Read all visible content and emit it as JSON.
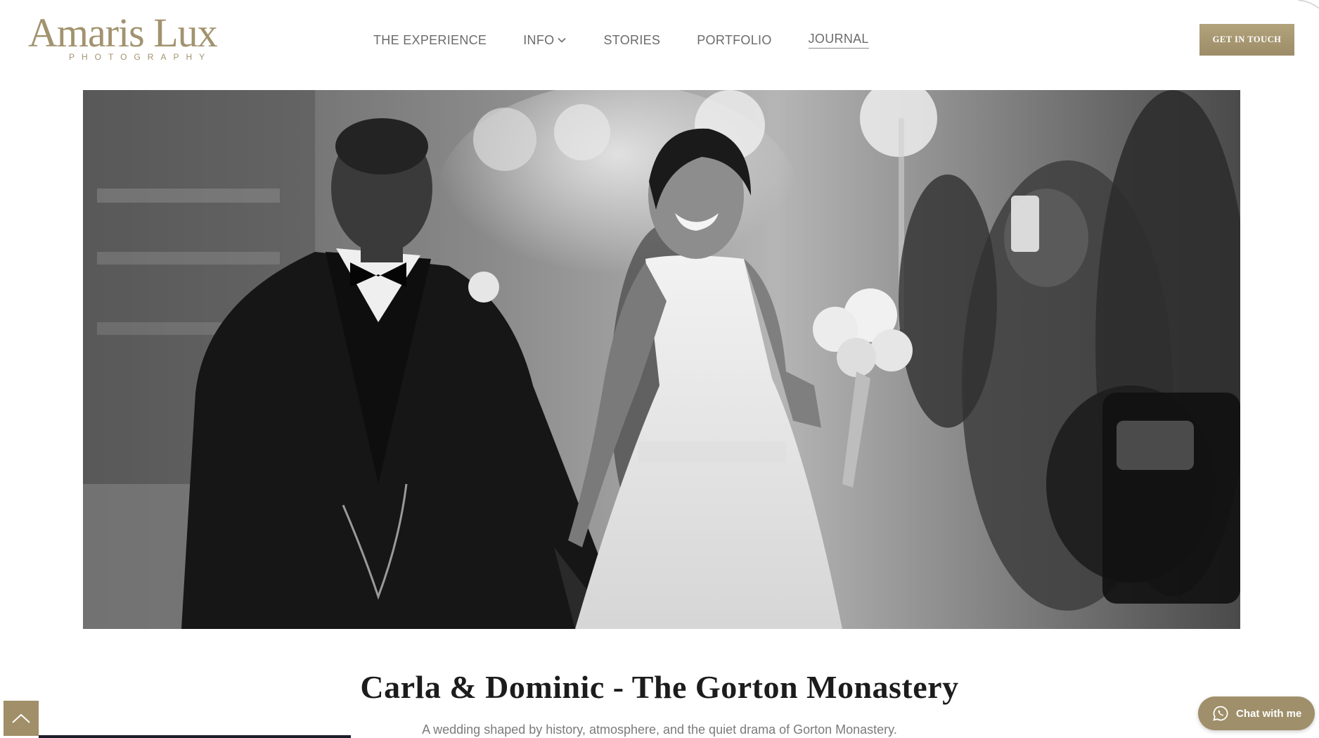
{
  "brand": {
    "name": "Amaris Lux",
    "tagline": "PHOTOGRAPHY"
  },
  "nav": {
    "items": [
      {
        "label": "THE EXPERIENCE"
      },
      {
        "label": "INFO"
      },
      {
        "label": "STORIES"
      },
      {
        "label": "PORTFOLIO"
      },
      {
        "label": "JOURNAL"
      }
    ]
  },
  "header": {
    "cta_label": "GET IN TOUCH"
  },
  "post": {
    "title": "Carla & Dominic - The Gorton Monastery",
    "subtitle": "A wedding shaped by history, atmosphere, and the quiet drama of Gorton Monastery."
  },
  "chat": {
    "label": "Chat with me"
  },
  "colors": {
    "accent": "#a2936f",
    "text_dark": "#1c1c1c",
    "nav_text": "#6b6b6b"
  }
}
